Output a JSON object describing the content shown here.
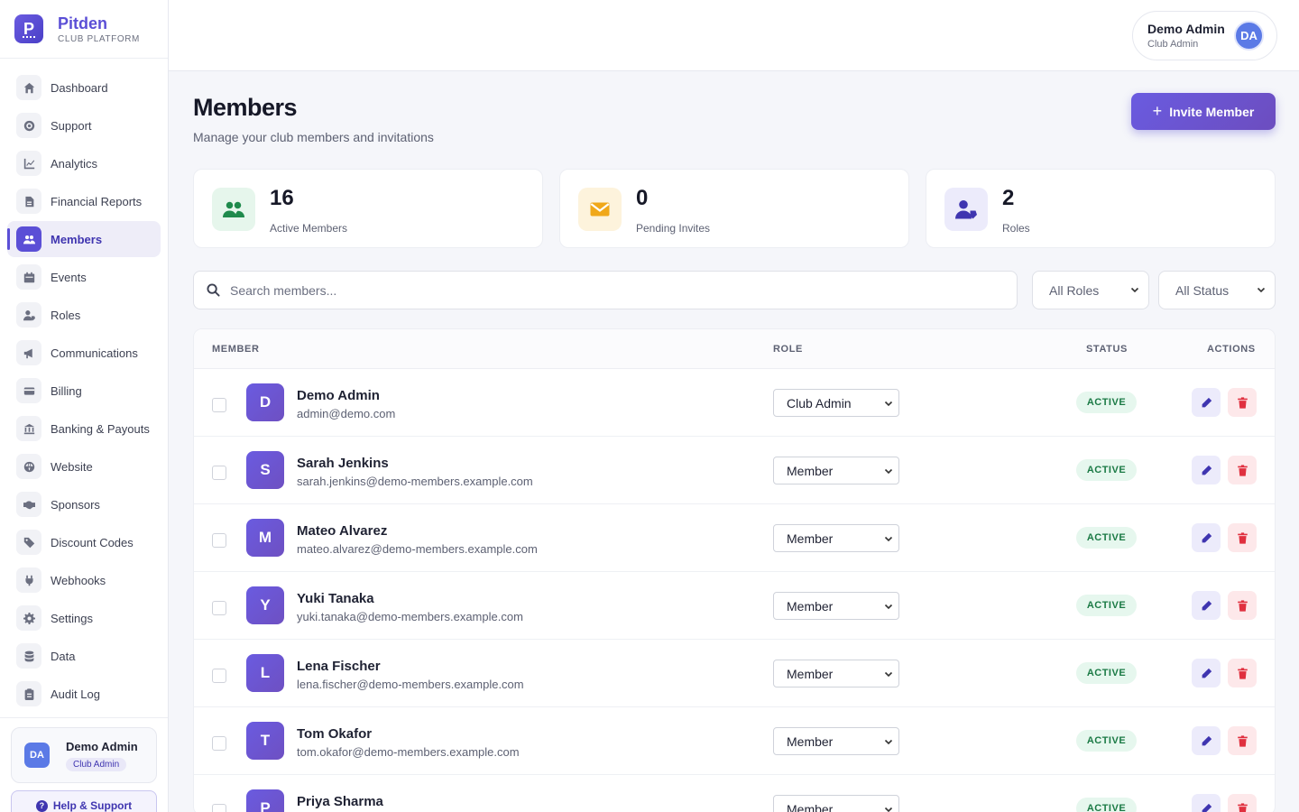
{
  "brand": {
    "name": "Pitden",
    "subtitle": "CLUB PLATFORM",
    "logo_letter": "P"
  },
  "sidebar": {
    "items": [
      {
        "label": "Dashboard",
        "icon": "home-icon"
      },
      {
        "label": "Support",
        "icon": "lifebuoy-icon"
      },
      {
        "label": "Analytics",
        "icon": "chart-line-icon"
      },
      {
        "label": "Financial Reports",
        "icon": "file-invoice-icon"
      },
      {
        "label": "Members",
        "icon": "users-icon",
        "active": true
      },
      {
        "label": "Events",
        "icon": "calendar-icon"
      },
      {
        "label": "Roles",
        "icon": "user-tag-icon"
      },
      {
        "label": "Communications",
        "icon": "megaphone-icon"
      },
      {
        "label": "Billing",
        "icon": "credit-card-icon"
      },
      {
        "label": "Banking & Payouts",
        "icon": "bank-icon"
      },
      {
        "label": "Website",
        "icon": "globe-icon"
      },
      {
        "label": "Sponsors",
        "icon": "handshake-icon"
      },
      {
        "label": "Discount Codes",
        "icon": "tags-icon"
      },
      {
        "label": "Webhooks",
        "icon": "plug-icon"
      },
      {
        "label": "Settings",
        "icon": "gear-icon"
      },
      {
        "label": "Data",
        "icon": "database-icon"
      },
      {
        "label": "Audit Log",
        "icon": "clipboard-icon"
      }
    ],
    "user": {
      "initials": "DA",
      "name": "Demo Admin",
      "role": "Club Admin"
    },
    "help_label": "Help & Support"
  },
  "topbar": {
    "user_name": "Demo Admin",
    "user_role": "Club Admin",
    "initials": "DA"
  },
  "page": {
    "title": "Members",
    "subtitle": "Manage your club members and invitations",
    "invite_label": "Invite Member"
  },
  "stats": [
    {
      "value": "16",
      "label": "Active Members",
      "icon": "users-icon",
      "bg": "#e6f6ec",
      "fg": "#1f8a4c"
    },
    {
      "value": "0",
      "label": "Pending Invites",
      "icon": "envelope-icon",
      "bg": "#fdf3dc",
      "fg": "#f0a81a"
    },
    {
      "value": "2",
      "label": "Roles",
      "icon": "user-tag-icon",
      "bg": "#ecebfb",
      "fg": "#3f35b0"
    }
  ],
  "filters": {
    "search_placeholder": "Search members...",
    "roles_value": "All Roles",
    "status_value": "All Status"
  },
  "table": {
    "headers": {
      "member": "MEMBER",
      "role": "ROLE",
      "status": "STATUS",
      "actions": "ACTIONS"
    },
    "rows": [
      {
        "initial": "D",
        "name": "Demo Admin",
        "email": "admin@demo.com",
        "role": "Club Admin",
        "status": "ACTIVE"
      },
      {
        "initial": "S",
        "name": "Sarah Jenkins",
        "email": "sarah.jenkins@demo-members.example.com",
        "role": "Member",
        "status": "ACTIVE"
      },
      {
        "initial": "M",
        "name": "Mateo Alvarez",
        "email": "mateo.alvarez@demo-members.example.com",
        "role": "Member",
        "status": "ACTIVE"
      },
      {
        "initial": "Y",
        "name": "Yuki Tanaka",
        "email": "yuki.tanaka@demo-members.example.com",
        "role": "Member",
        "status": "ACTIVE"
      },
      {
        "initial": "L",
        "name": "Lena Fischer",
        "email": "lena.fischer@demo-members.example.com",
        "role": "Member",
        "status": "ACTIVE"
      },
      {
        "initial": "T",
        "name": "Tom Okafor",
        "email": "tom.okafor@demo-members.example.com",
        "role": "Member",
        "status": "ACTIVE"
      },
      {
        "initial": "P",
        "name": "Priya Sharma",
        "email": "",
        "role": "Member",
        "status": "ACTIVE"
      }
    ]
  },
  "colors": {
    "accent": "#5b4fd6",
    "active_badge_bg": "#e6f7ee",
    "active_badge_fg": "#1b7a45",
    "delete": "#e0303f"
  }
}
